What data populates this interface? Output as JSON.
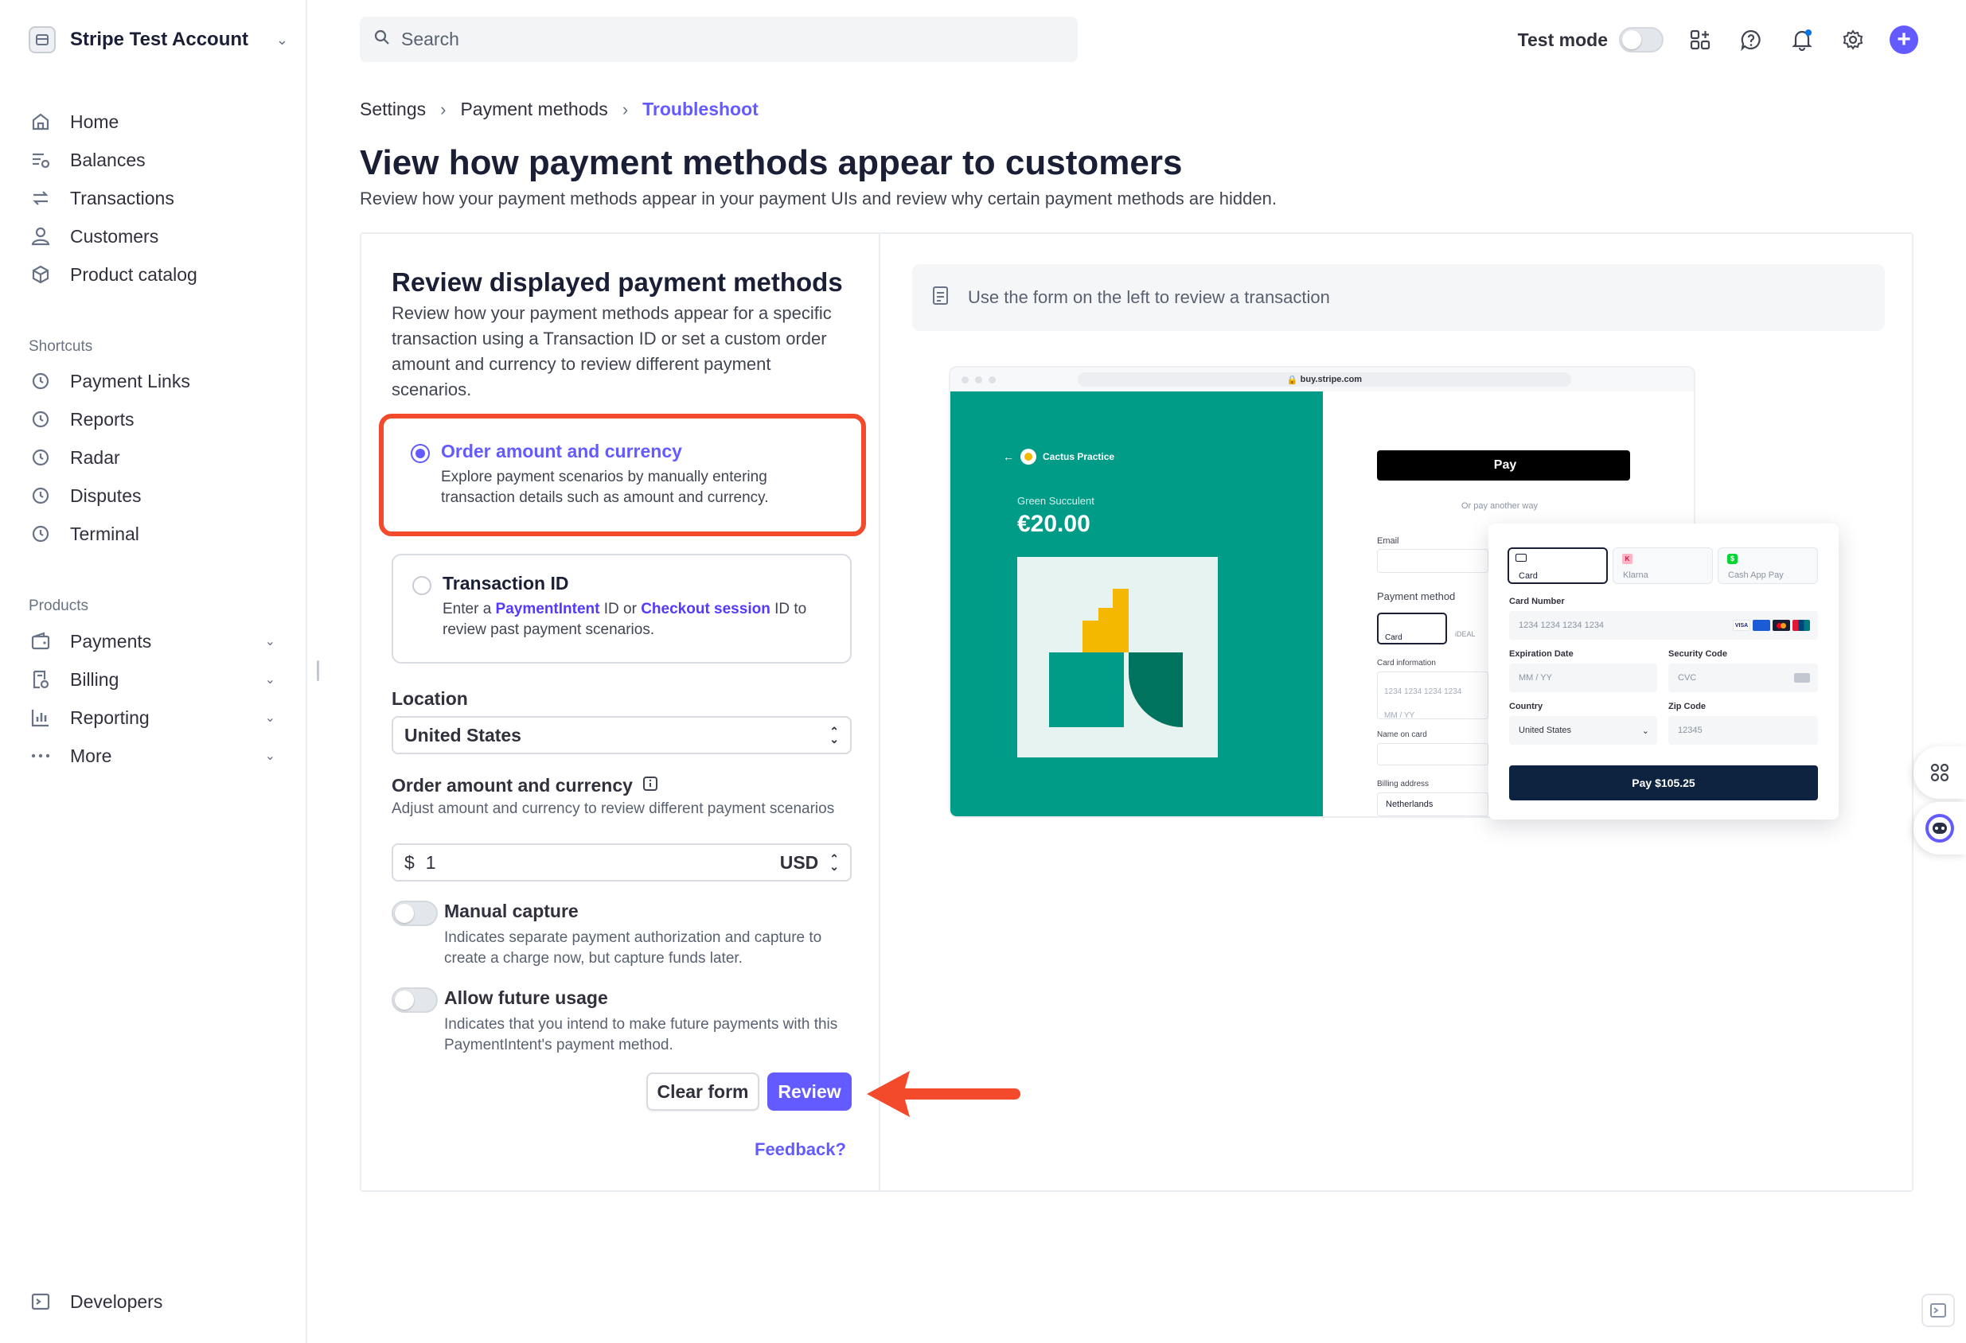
{
  "sidebar": {
    "account_name": "Stripe Test Account",
    "nav": [
      {
        "label": "Home"
      },
      {
        "label": "Balances"
      },
      {
        "label": "Transactions"
      },
      {
        "label": "Customers"
      },
      {
        "label": "Product catalog"
      }
    ],
    "shortcuts_title": "Shortcuts",
    "shortcuts": [
      {
        "label": "Payment Links"
      },
      {
        "label": "Reports"
      },
      {
        "label": "Radar"
      },
      {
        "label": "Disputes"
      },
      {
        "label": "Terminal"
      }
    ],
    "products_title": "Products",
    "products": [
      {
        "label": "Payments"
      },
      {
        "label": "Billing"
      },
      {
        "label": "Reporting"
      },
      {
        "label": "More"
      }
    ],
    "developers": "Developers"
  },
  "header": {
    "search_placeholder": "Search",
    "test_mode_label": "Test mode",
    "test_mode_on": false
  },
  "breadcrumb": [
    "Settings",
    "Payment methods",
    "Troubleshoot"
  ],
  "page": {
    "title": "View how payment methods appear to customers",
    "subtitle": "Review how your payment methods appear in your payment UIs and review why certain payment methods are hidden."
  },
  "form": {
    "title": "Review displayed payment methods",
    "description": "Review how your payment methods appear for a specific transaction using a Transaction ID or set a custom order amount and currency to review different payment scenarios.",
    "option_amount": {
      "title": "Order amount and currency",
      "description": "Explore payment scenarios by manually entering transaction details such as amount and currency.",
      "selected": true
    },
    "option_txn": {
      "title": "Transaction ID",
      "desc_prefix": "Enter a ",
      "link1": "PaymentIntent",
      "desc_mid": " ID or ",
      "link2": "Checkout session",
      "desc_suffix": " ID to review past payment scenarios.",
      "selected": false
    },
    "location_label": "Location",
    "location_value": "United States",
    "amount_label": "Order amount and currency",
    "amount_help": "Adjust amount and currency to review different payment scenarios",
    "currency_symbol": "$",
    "amount_value": "1",
    "currency": "USD",
    "manual_capture": {
      "title": "Manual capture",
      "description": "Indicates separate payment authorization and capture to create a charge now, but capture funds later.",
      "on": false
    },
    "future_usage": {
      "title": "Allow future usage",
      "description": "Indicates that you intend to make future payments with this PaymentIntent's payment method.",
      "on": false
    },
    "clear_label": "Clear form",
    "review_label": "Review",
    "feedback_label": "Feedback?"
  },
  "preview": {
    "info_text": "Use the form on the left to review a transaction",
    "mock": {
      "url": "buy.stripe.com",
      "merchant": "Cactus Practice",
      "product": "Green Succulent",
      "price": "€20.00",
      "apple_pay": "Pay",
      "or_pay": "Or pay another way",
      "email_label": "Email",
      "payment_method_label": "Payment method",
      "card_tab": "Card",
      "ideal_tab": "iDEAL",
      "card_info_label": "Card information",
      "card_info_placeholder": "1234 1234 1234 1234",
      "mmyy_small": "MM / YY",
      "name_label": "Name on card",
      "billing_label": "Billing address",
      "billing_value": "Netherlands",
      "tabs": [
        "Card",
        "Klarna",
        "Cash App Pay"
      ],
      "card_number_label": "Card Number",
      "card_number_placeholder": "1234 1234 1234 1234",
      "exp_label": "Expiration Date",
      "exp_placeholder": "MM / YY",
      "cvc_label": "Security Code",
      "cvc_placeholder": "CVC",
      "country_label": "Country",
      "country_value": "United States",
      "zip_label": "Zip Code",
      "zip_placeholder": "12345",
      "pay_button": "Pay $105.25"
    }
  },
  "colors": {
    "accent": "#635bff",
    "annotation": "#f24a2a",
    "mock_green": "#009c87"
  }
}
